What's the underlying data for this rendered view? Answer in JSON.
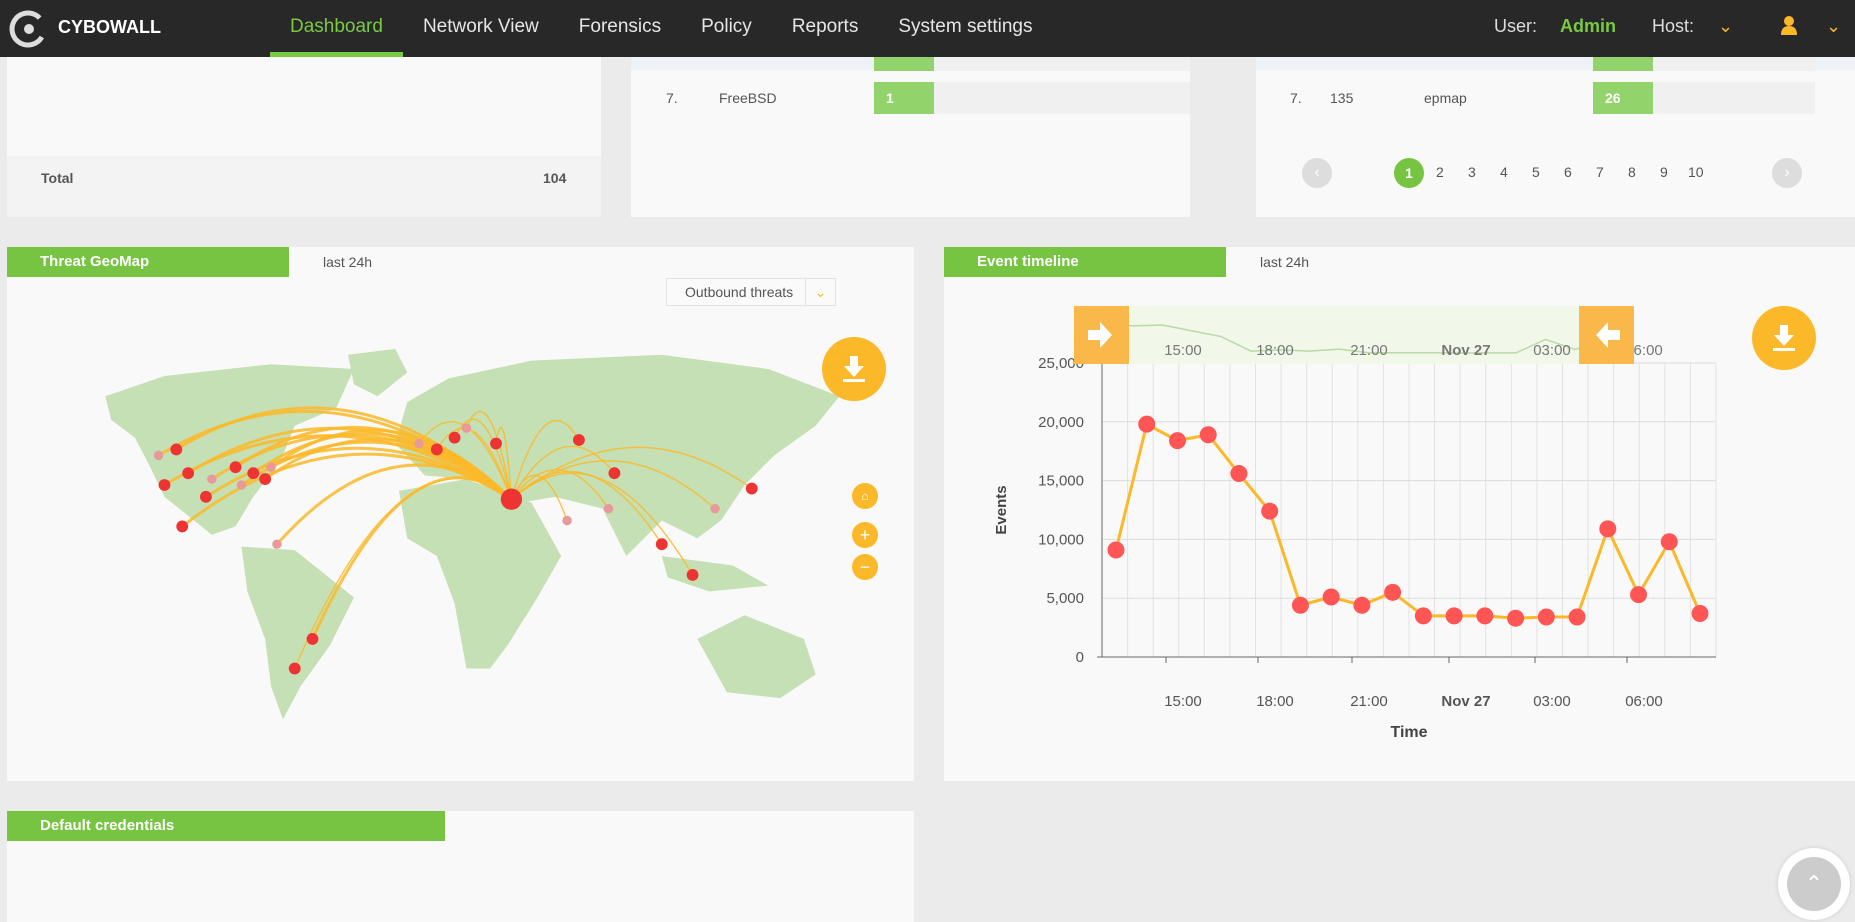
{
  "header": {
    "brand": "CYBOWALL",
    "nav": [
      "Dashboard",
      "Network View",
      "Forensics",
      "Policy",
      "Reports",
      "System settings"
    ],
    "user_label": "User:",
    "user_name": "Admin",
    "host_label": "Host:"
  },
  "os_panel": {
    "total_label": "Total",
    "total_value": "104"
  },
  "os_list": {
    "rank": "7.",
    "name": "FreeBSD",
    "count": "1"
  },
  "ports_list": {
    "rank": "7.",
    "port": "135",
    "service": "epmap",
    "count": "26",
    "pages": [
      "1",
      "2",
      "3",
      "4",
      "5",
      "6",
      "7",
      "8",
      "9",
      "10"
    ],
    "current_page": "1"
  },
  "geomap": {
    "title": "Threat GeoMap",
    "range": "last 24h",
    "filter": "Outbound threats"
  },
  "timeline": {
    "title": "Event timeline",
    "range": "last 24h"
  },
  "credentials": {
    "title": "Default credentials"
  },
  "colors": {
    "accent": "#76c442",
    "orange": "#fbb829",
    "point": "#ff5555",
    "header": "#282828"
  },
  "chart_data": {
    "type": "line",
    "title": "Event timeline",
    "xlabel": "Time",
    "ylabel": "Events",
    "ylim": [
      0,
      25000
    ],
    "yticks": [
      "0",
      "5,000",
      "10,000",
      "15,000",
      "20,000",
      "25,000"
    ],
    "xticks": [
      "15:00",
      "18:00",
      "21:00",
      "Nov 27",
      "03:00",
      "06:00"
    ],
    "values": [
      9100,
      19800,
      18400,
      18900,
      15600,
      12400,
      4400,
      5100,
      4400,
      5500,
      3500,
      3500,
      3500,
      3300,
      3400,
      3400,
      10900,
      5300,
      9800,
      3700
    ]
  }
}
